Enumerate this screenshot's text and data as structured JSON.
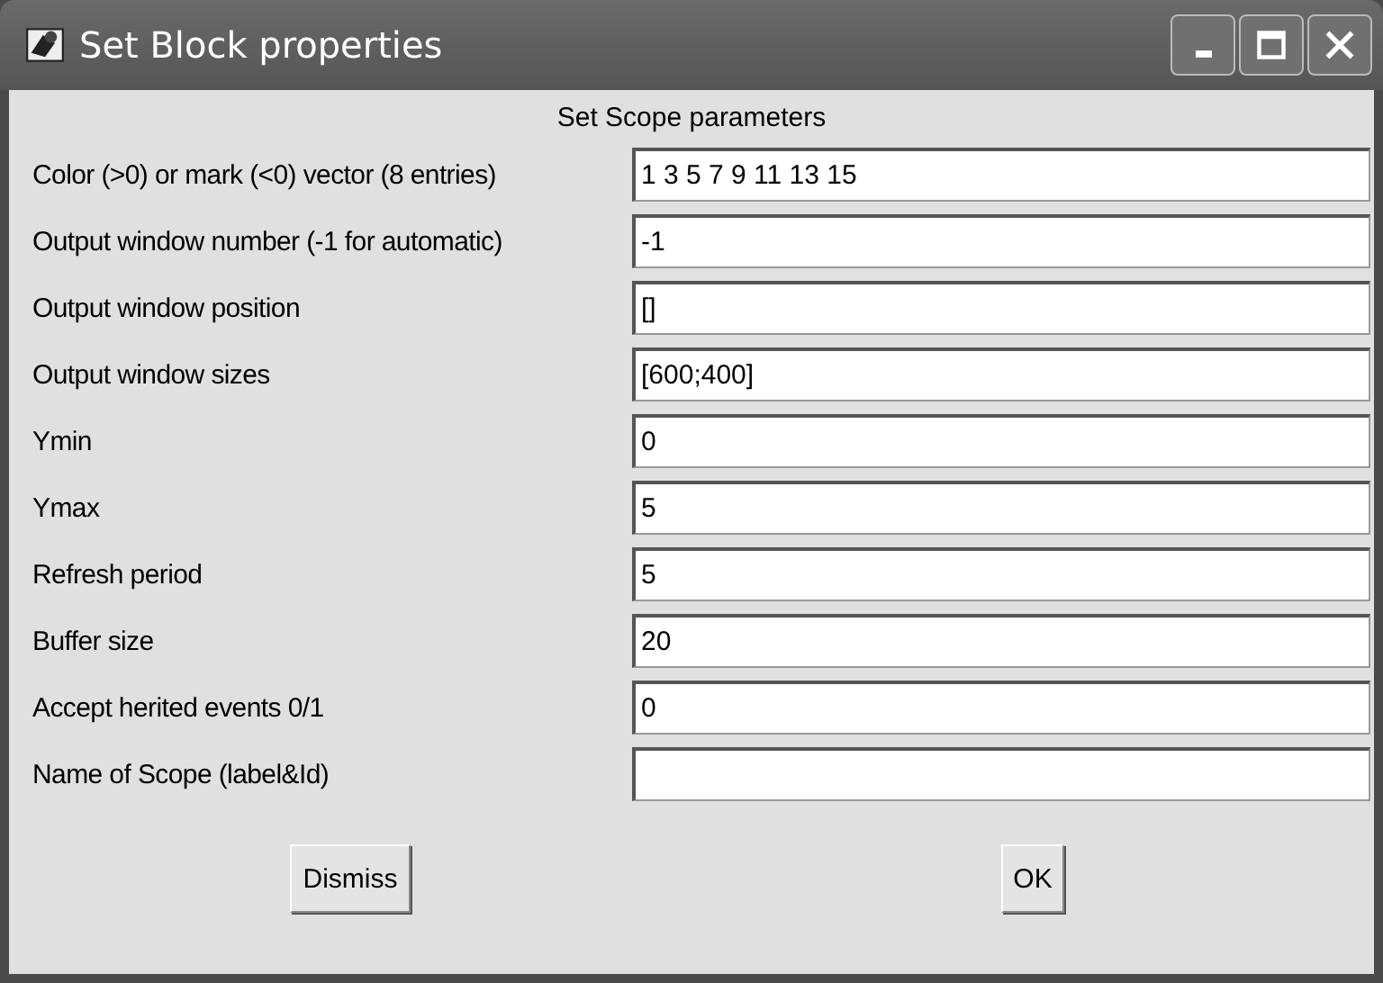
{
  "window": {
    "title": "Set Block properties"
  },
  "heading": "Set Scope parameters",
  "fields": [
    {
      "label": "Color (>0) or mark (<0) vector (8 entries)",
      "value": "1 3 5 7 9 11 13 15"
    },
    {
      "label": "Output window number (-1 for automatic)",
      "value": "-1"
    },
    {
      "label": "Output window position",
      "value": "[]"
    },
    {
      "label": "Output window sizes",
      "value": "[600;400]"
    },
    {
      "label": "Ymin",
      "value": "0"
    },
    {
      "label": "Ymax",
      "value": "5"
    },
    {
      "label": "Refresh period",
      "value": "5"
    },
    {
      "label": "Buffer size",
      "value": "20"
    },
    {
      "label": "Accept herited events 0/1",
      "value": "0"
    },
    {
      "label": "Name of Scope (label&Id)"
    }
  ],
  "buttons": [
    "Dismiss",
    "OK"
  ]
}
